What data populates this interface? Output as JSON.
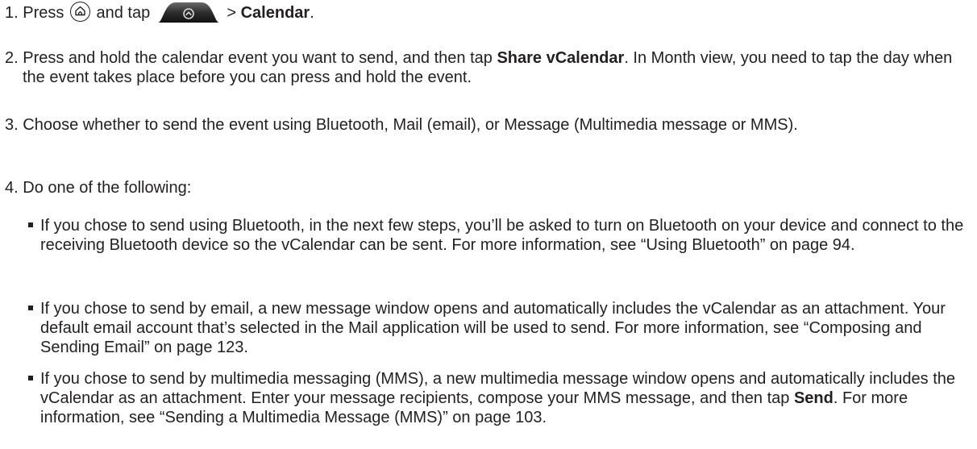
{
  "steps": [
    {
      "number": "1.",
      "press": "Press",
      "and_tap": "and tap",
      "arrow": ">",
      "target": "Calendar",
      "end": ".",
      "icons": [
        "home-icon",
        "all-apps-tab-icon"
      ]
    },
    {
      "number": "2.",
      "before": "Press and hold the calendar event you want to send, and then tap",
      "bold": "Share vCalendar",
      "after": ". In Month view, you need to tap the day when the event takes place before you can press and hold the event."
    },
    {
      "number": "3.",
      "text": "Choose whether to send the event using Bluetooth, Mail (email), or Message (Multimedia message or MMS)."
    },
    {
      "number": "4.",
      "text": "Do one of the following:"
    }
  ],
  "bullets": [
    {
      "text": "If you chose to send using Bluetooth, in the next few steps, you’ll be asked to turn on Bluetooth on your device and connect to the receiving Bluetooth device so the vCalendar can be sent. For more information, see “Using Bluetooth” on page 94."
    },
    {
      "text": "If you chose to send by email, a new message window opens and automatically includes the vCalendar as an attachment. Your default email account that’s selected in the Mail application will be used to send. For more information, see “Composing and Sending Email” on page 123."
    },
    {
      "before": "If you chose to send by multimedia messaging (MMS), a new multimedia message window opens and automatically includes the vCalendar as an attachment. Enter your message recipients, compose your MMS message, and then tap",
      "bold": "Send",
      "after": ". For more information, see “Sending a Multimedia Message (MMS)” on page 103."
    }
  ]
}
